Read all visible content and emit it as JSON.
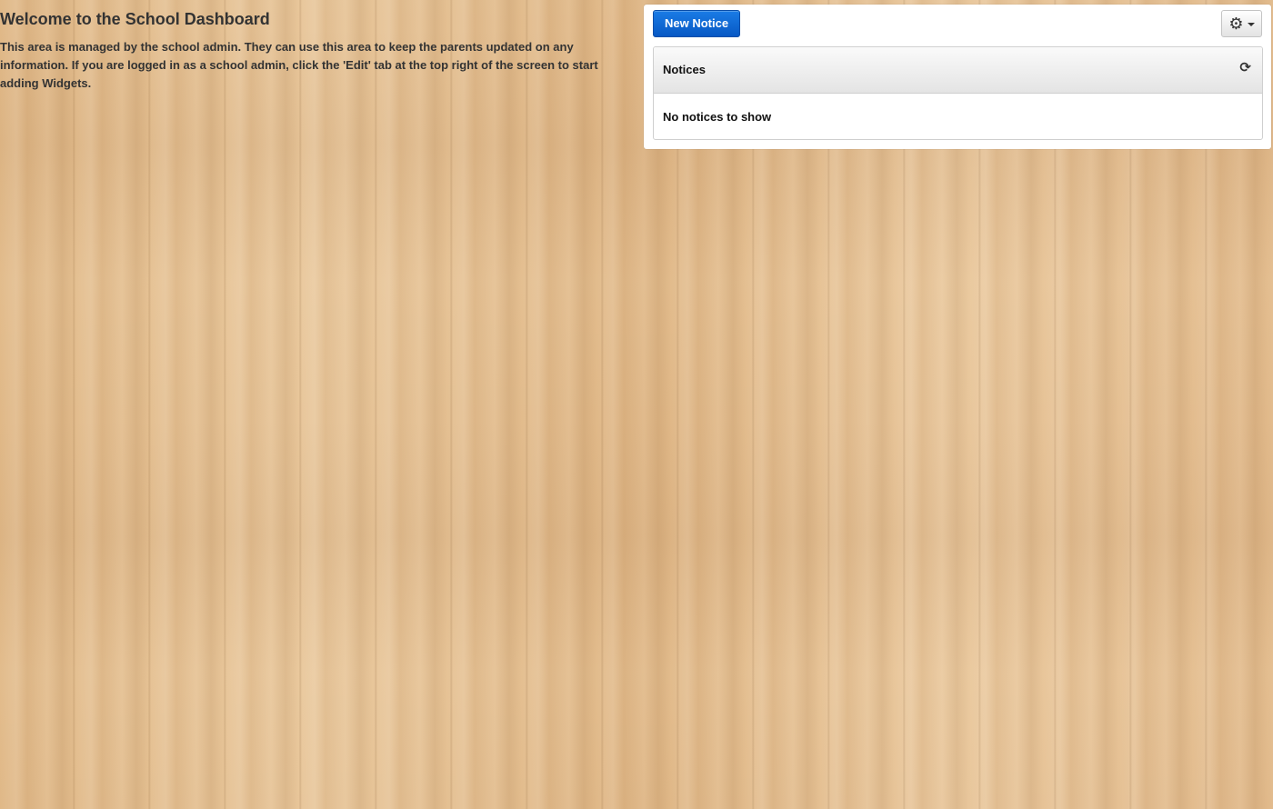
{
  "welcome": {
    "title": "Welcome to the School Dashboard",
    "body": "This area is managed by the school admin. They can use this area to keep the parents updated on any information. If you are logged in as a school admin, click the 'Edit' tab at the top right of the screen to start adding Widgets."
  },
  "notice_panel": {
    "new_notice_label": "New Notice",
    "settings_icon": "gear-icon",
    "notices_title": "Notices",
    "refresh_icon": "refresh-icon",
    "empty_message": "No notices to show"
  },
  "colors": {
    "primary_button": "#0a66d6",
    "background_wood": "#e2bc8c",
    "text": "#333333"
  }
}
